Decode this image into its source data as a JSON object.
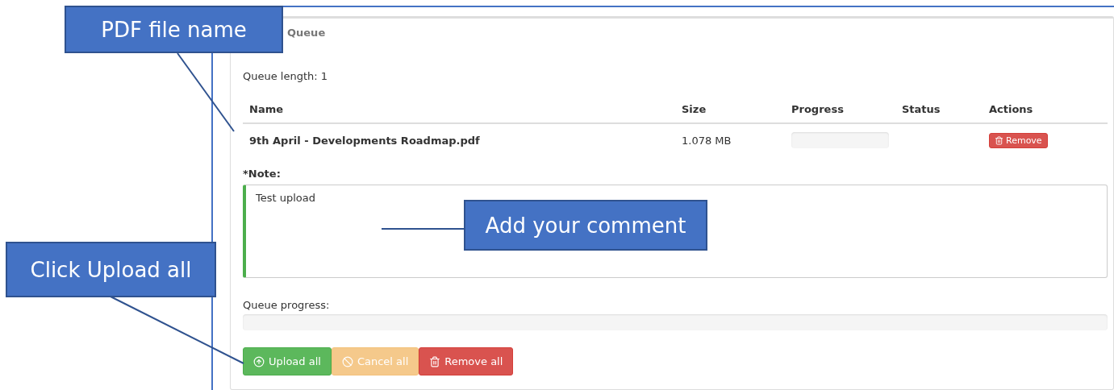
{
  "panel": {
    "title": "Queue",
    "queue_length": "Queue length: 1",
    "table": {
      "columns": [
        "Name",
        "Size",
        "Progress",
        "Status",
        "Actions"
      ],
      "rows": [
        {
          "name": "9th April - Developments Roadmap.pdf",
          "size": "1.078 MB",
          "progress": {
            "level": 0
          },
          "action": "Remove"
        }
      ]
    },
    "note": {
      "label": "*Note:",
      "value": "Test upload"
    },
    "queue_progress": {
      "label": "Queue progress:",
      "level": 0
    },
    "buttons": [
      {
        "label": "Upload all",
        "kind": "upload",
        "disabled": false
      },
      {
        "label": "Cancel all",
        "kind": "cancel",
        "disabled": true
      },
      {
        "label": "Remove all",
        "kind": "remove",
        "disabled": false
      }
    ]
  },
  "callouts": [
    {
      "text": "PDF file name"
    },
    {
      "text": "Add your comment"
    },
    {
      "text": "Click Upload all"
    }
  ]
}
